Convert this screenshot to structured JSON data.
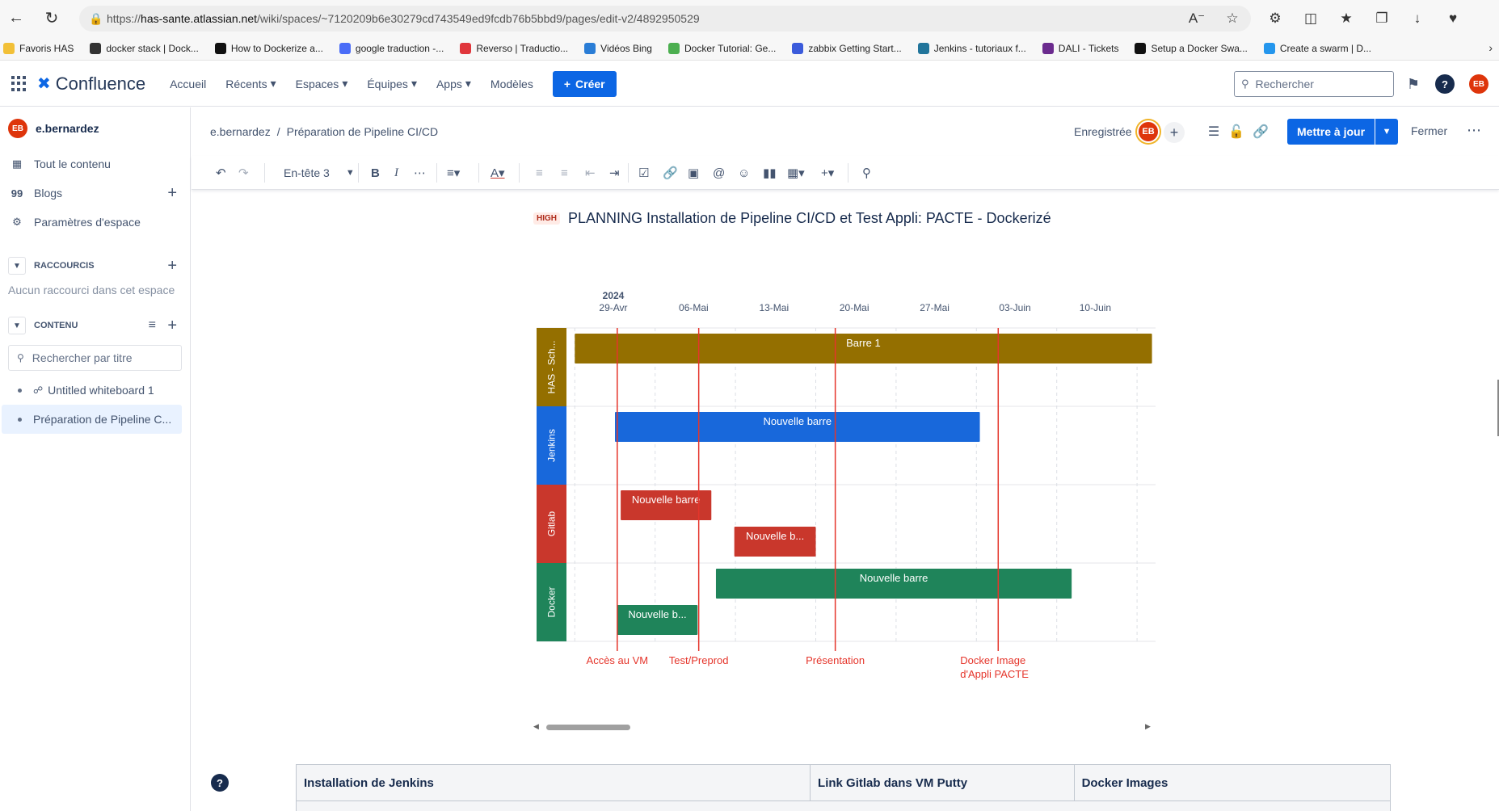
{
  "browser": {
    "url_prefix": "https://",
    "url_host": "has-sante.atlassian.net",
    "url_path": "/wiki/spaces/~7120209b6e30279cd743549ed9fcdb76b5bbd9/pages/edit-v2/4892950529",
    "bookmarks": [
      {
        "label": "Favoris HAS",
        "color": "#f2c037"
      },
      {
        "label": "docker stack | Dock...",
        "color": "#333333"
      },
      {
        "label": "How to Dockerize a...",
        "color": "#111111"
      },
      {
        "label": "google traduction -...",
        "color": "#4a6cf7"
      },
      {
        "label": "Reverso | Traductio...",
        "color": "#e0363c"
      },
      {
        "label": "Vidéos Bing",
        "color": "#2a7dd6"
      },
      {
        "label": "Docker Tutorial: Ge...",
        "color": "#4caf50"
      },
      {
        "label": "zabbix Getting Start...",
        "color": "#3b5bdb"
      },
      {
        "label": "Jenkins - tutoriaux f...",
        "color": "#21759b"
      },
      {
        "label": "DALI - Tickets",
        "color": "#6b2b8e"
      },
      {
        "label": "Setup a Docker Swa...",
        "color": "#111111"
      },
      {
        "label": "Create a swarm | D...",
        "color": "#2496ed"
      }
    ]
  },
  "header": {
    "logo": "Confluence",
    "nav": [
      "Accueil",
      "Récents",
      "Espaces",
      "Équipes",
      "Apps",
      "Modèles"
    ],
    "create": "Créer",
    "search_placeholder": "Rechercher",
    "avatar": "EB"
  },
  "sidebar": {
    "user": "e.bernardez",
    "items": [
      {
        "label": "Tout le contenu"
      },
      {
        "label": "Blogs"
      },
      {
        "label": "Paramètres d'espace"
      }
    ],
    "shortcuts_title": "RACCOURCIS",
    "shortcuts_empty": "Aucun raccourci dans cet espace",
    "content_title": "CONTENU",
    "search_placeholder": "Rechercher par titre",
    "tree": [
      {
        "label": "Untitled whiteboard 1"
      },
      {
        "label": "Préparation de Pipeline C..."
      }
    ]
  },
  "editbar": {
    "breadcrumb": [
      "e.bernardez",
      "Préparation de Pipeline CI/CD"
    ],
    "separator": "/",
    "status": "Enregistrée",
    "avatar": "EB",
    "update": "Mettre à jour",
    "close": "Fermer"
  },
  "toolbar": {
    "heading_style": "En-tête 3"
  },
  "page": {
    "lozenge": "HIGH",
    "title": "PLANNING Installation de Pipeline CI/CD et Test Appli: PACTE - Dockerizé"
  },
  "roadmap": {
    "year": "2024",
    "dates": [
      "29-Avr",
      "06-Mai",
      "13-Mai",
      "20-Mai",
      "27-Mai",
      "03-Juin",
      "10-Juin"
    ],
    "lanes": [
      {
        "label": "HAS - Sch...",
        "color": "#946f00"
      },
      {
        "label": "Jenkins",
        "color": "#1868db"
      },
      {
        "label": "Gitlab",
        "color": "#c9372c"
      },
      {
        "label": "Docker",
        "color": "#1f845a"
      }
    ],
    "bars": [
      {
        "lane": 0,
        "label": "Barre 1",
        "start_day": -3.5,
        "end_day": 46.8,
        "row": 0
      },
      {
        "lane": 1,
        "label": "Nouvelle barre",
        "start_day": 0,
        "end_day": 31.8,
        "row": 0
      },
      {
        "lane": 2,
        "label": "Nouvelle barre",
        "start_day": 0.5,
        "end_day": 8.4,
        "row": 0
      },
      {
        "lane": 2,
        "label": "Nouvelle b...",
        "start_day": 10.4,
        "end_day": 17.5,
        "row": 1
      },
      {
        "lane": 3,
        "label": "Nouvelle barre",
        "start_day": 8.8,
        "end_day": 39.8,
        "row": 0
      },
      {
        "lane": 3,
        "label": "Nouvelle b...",
        "start_day": 0.2,
        "end_day": 7.2,
        "row": 1
      }
    ],
    "markers": [
      {
        "label": "Accès au VM",
        "day": 0.2
      },
      {
        "label": "Test/Preprod",
        "day": 7.3
      },
      {
        "label": "Présentation",
        "day": 19.2
      },
      {
        "label": "Docker Image",
        "label2": "d'Appli PACTE",
        "day": 33.4
      }
    ],
    "marker_color": "#e5352b"
  },
  "table": {
    "headers": [
      "Installation de Jenkins",
      "Link Gitlab dans VM Putty",
      "Docker Images"
    ]
  }
}
